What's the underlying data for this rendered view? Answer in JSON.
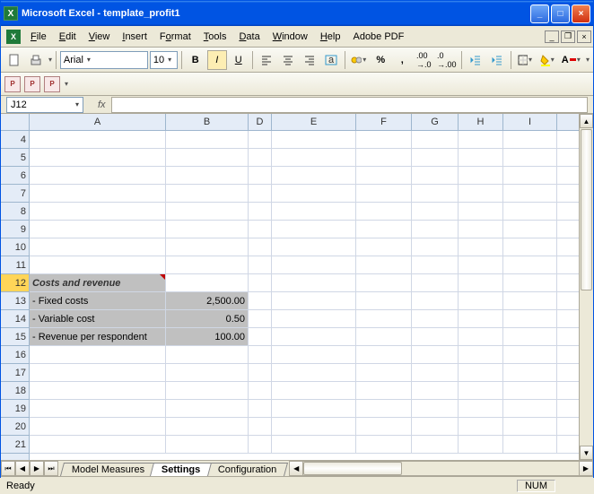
{
  "window": {
    "title": "Microsoft Excel - template_profit1"
  },
  "menu": {
    "file": "File",
    "edit": "Edit",
    "view": "View",
    "insert": "Insert",
    "format": "Format",
    "tools": "Tools",
    "data": "Data",
    "window": "Window",
    "help": "Help",
    "adobe": "Adobe PDF"
  },
  "toolbar": {
    "font": "Arial",
    "size": "10"
  },
  "namebox": {
    "value": "J12"
  },
  "columns": [
    "A",
    "B",
    "D",
    "E",
    "F",
    "G",
    "H",
    "I"
  ],
  "rows_pre": [
    "4",
    "5",
    "6",
    "7",
    "8",
    "9",
    "10",
    "11"
  ],
  "sheet": {
    "header_row": "12",
    "header_label": "Costs and revenue",
    "data": [
      {
        "row": "13",
        "label": "- Fixed costs",
        "value": "2,500.00"
      },
      {
        "row": "14",
        "label": "- Variable cost",
        "value": "0.50"
      },
      {
        "row": "15",
        "label": "- Revenue per respondent",
        "value": "100.00"
      }
    ]
  },
  "rows_post": [
    "16",
    "17",
    "18",
    "19",
    "20",
    "21"
  ],
  "tabs": {
    "t1": "Model Measures",
    "t2": "Settings",
    "t3": "Configuration"
  },
  "status": {
    "ready": "Ready",
    "num": "NUM"
  }
}
